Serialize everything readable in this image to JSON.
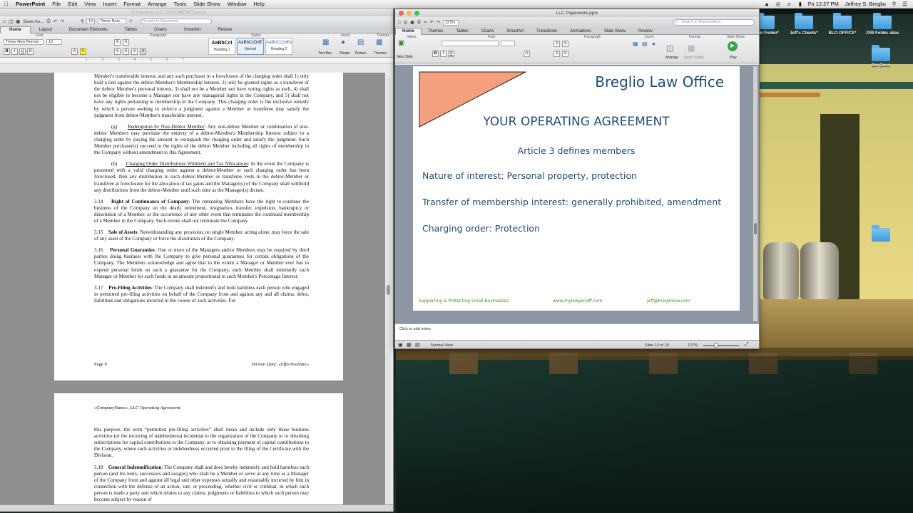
{
  "menubar": {
    "app": "PowerPoint",
    "menus": [
      "File",
      "Edit",
      "View",
      "Insert",
      "Format",
      "Arrange",
      "Tools",
      "Slide Show",
      "Window",
      "Help"
    ],
    "clock": "Fri 12:27 PM",
    "user": "Jeffrey S. Breglio"
  },
  "word": {
    "title": "3 Standard LLC DOCUMENTS.docx",
    "toolbar": {
      "save_as": "Save As...",
      "zoom": "12",
      "font_box": "Times New...",
      "search_placeholder": "Search in Document"
    },
    "tabs": [
      "Home",
      "Layout",
      "Document Elements",
      "Tables",
      "Charts",
      "SmartArt",
      "Review"
    ],
    "ribbon": {
      "groups": {
        "font": "Font",
        "paragraph": "Paragraph",
        "styles": "Styles",
        "insert": "Insert",
        "themes": "Themes"
      },
      "font_name": "Times New Roman",
      "font_size": "12",
      "styles": [
        {
          "sample": "AaBbCcI",
          "name": "Heading 1"
        },
        {
          "sample": "AaBbCcDdE",
          "name": "Normal"
        },
        {
          "sample": "AaBbCcDdEe",
          "name": "Heading 2"
        }
      ],
      "insert_buttons": [
        "Text Box",
        "Shape",
        "Picture",
        "Themes"
      ]
    },
    "page1": {
      "para_intro": "law, a Member's creditors or judgment creditors shall only be afforded a charging order against the debtor Member's transferable interest, and any such purchaser in a foreclosure of the charging order shall 1) only hold a lien against the debtor-Member's Membership Interest, 2) only be granted rights as a transferee of the debtor Member's personal interest, 3) shall not be a Member nor have voting rights as such, 4) shall not be eligible to become a Manager nor have any managerial rights in the Company, and 5) shall not have any rights pertaining to membership in the Company. This charging order is the exclusive remedy by which a person seeking to enforce a judgment against a Member or transferee may satisfy the judgment from debtor-Member's transferable interest.",
      "g_label": "(g)",
      "g_title": "Redemption by Non-Debtor Member",
      "g_text": ": Any non-debtor Member or combination of non-debtor Members may purchase the entirety of a debtor-Member's Membership Interest subject to a charging order by paying the amount to extinguish the charging order and satisfy the judgment. Such Member purchaser(s) succeed to the rights of the debtor Member including all rights of membership in the Company without amendment to this Agreement.",
      "h_label": "(h)",
      "h_title": "Charging Order Distributions Withheld and Tax Allocations",
      "h_text": ": In the event the Company is presented with a valid charging order against a debtor-Member or such charging order has been foreclosed, then any distribution to such debtor-Member or transferee vests in the debtor-Member or transferee at foreclosure for the allocation of tax gains and the Manager(s) of the Company shall withhold any distributions from the debtor-Member until such time as the Manager(s) dictate.",
      "s314_num": "3.14",
      "s314_title": "Right of Continuance of Company",
      "s314_text": ": The remaining Members have the right to continue the business of the Company on the death, retirement, resignation, transfer, expulsion, bankruptcy or dissolution of a Member, or the occurrence of any other event that terminates the continued membership of a Member in the Company. Such events shall not terminate the Company.",
      "s315_num": "3.15",
      "s315_title": "Sale of Assets",
      "s315_text": ": Notwithstanding any provision, no single Member, acting alone, may force the sale of any asset of the Company or force the dissolution of the Company.",
      "s316_num": "3.16",
      "s316_title": "Personal Guaranties",
      "s316_text": ": One or more of the Managers and/or Members may be required by third parties doing business with the Company to give personal guarantees for certain obligations of the Company.  The Members acknowledge and agree that to the extent a Manager or Member ever has to expend personal funds on such a guarantee for the Company, each Member shall indemnify such Manager or Member for such funds in an amount proportional to such Member's Percentage Interest.",
      "s317_num": "3.17",
      "s317_title": "Pre-Filing Activities",
      "s317_text": ": The Company shall indemnify and hold harmless each person who engaged in permitted pre-filing activities on behalf of the Company from and against any and all claims, debts, liabilities and obligations incurred in the course of such activities. For",
      "footer_page": "Page 9",
      "footer_version": "Version Date: «EffectiveDate»"
    },
    "page2": {
      "header": "«CompanyName», LLC Operating Agreement",
      "para1": "this purpose, the term “permitted pre-filing activities” shall mean and include only those business activities (or the incurring of indebtedness) incidental to the organization of the Company or to obtaining subscriptions for capital contributions to the Company, or to obtaining payment of capital contributions to the Company, where such activities or indebtedness occurred prior to the filing of the Certificate with the Division.",
      "s318_num": "3.18",
      "s318_title": "General Indemnification",
      "s318_text": ": The Company shall and does hereby indemnify and hold harmless each person (and his heirs, successors and assigns) who shall be a Member or serve at any time as a Manager of the Company from and against all legal and other expenses actually and reasonably incurred by him in connection with the defense of an action, suit, or proceeding, whether civil or criminal, in which such person is made a party and which relates to any claims, judgments or liabilities to which such person may become subject by reason of"
    }
  },
  "ppt": {
    "title": "LLC Paperwork.pptx",
    "zoom": "127%",
    "search_placeholder": "Search in Presentation",
    "tabs": [
      "Home",
      "Themes",
      "Tables",
      "Charts",
      "SmartArt",
      "Transitions",
      "Animations",
      "Slide Show",
      "Review"
    ],
    "ribbon_groups": [
      "Slides",
      "Font",
      "Paragraph",
      "Insert",
      "Format",
      "Slide Show"
    ],
    "ribbon_buttons": {
      "new_slide": "New Slide",
      "text": "Text",
      "picture": "Picture",
      "shape": "Shape",
      "arrange": "Arrange",
      "quick_styles": "Quick Styles",
      "play": "Play"
    },
    "slide": {
      "header_title": "Breglio Law Office",
      "title": "YOUR OPERATING AGREEMENT",
      "subtitle": "Article 3 defines members",
      "bullets": [
        "Nature of interest: Personal property, protection",
        "Transfer of membership interest: generally prohibited, amendment",
        "Charging order: Protection"
      ],
      "footer_left": "Supporting & Protecting Small Businesses",
      "footer_mid": "www.mylawyerjeff.com",
      "footer_right": "jeff@bregliolaw.com",
      "accent_color": "#f4a07f",
      "text_color": "#1f4e79"
    },
    "notes_placeholder": "Click to add notes",
    "status": {
      "view": "Normal View",
      "slide": "Slide 13 of 18",
      "zoom": "127%"
    }
  },
  "desktop_icons": [
    {
      "label": "...min Folder*"
    },
    {
      "label": "Jeff's Clients*"
    },
    {
      "label": "BLO OFFICE*"
    },
    {
      "label": "JSB Folder alias"
    },
    {
      "label": "Em Docs"
    }
  ]
}
